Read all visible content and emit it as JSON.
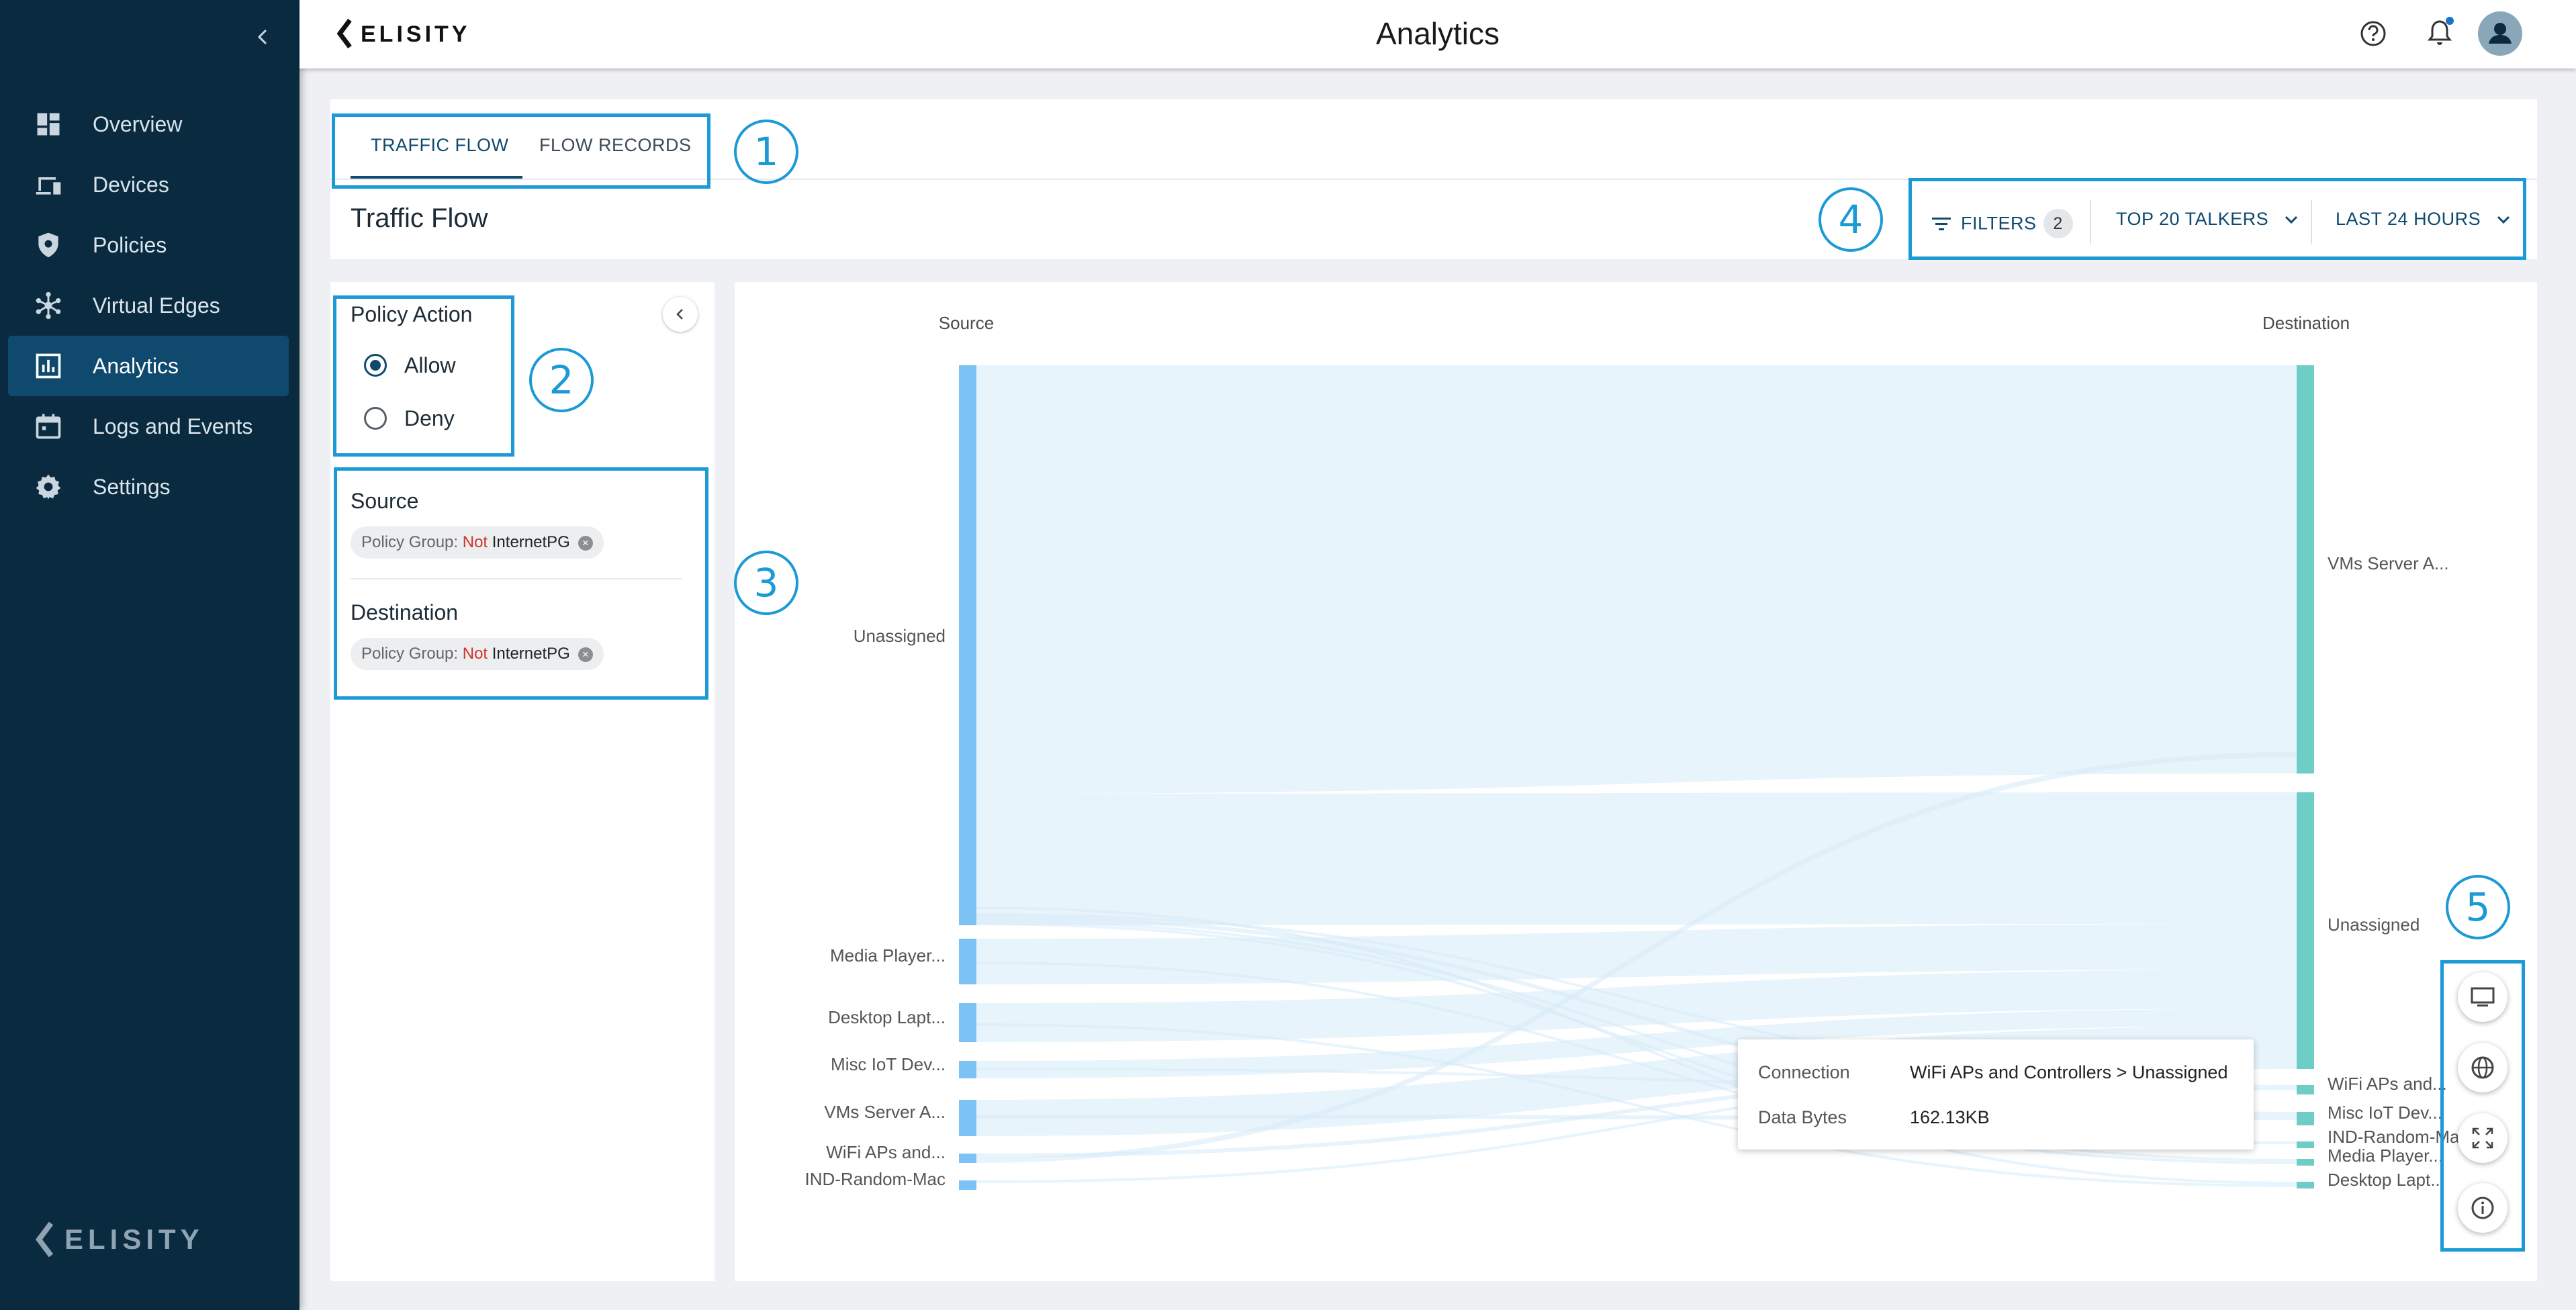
{
  "app": {
    "brand": "ELISITY",
    "page_title": "Analytics"
  },
  "sidebar": {
    "items": [
      {
        "label": "Overview",
        "icon": "dashboard-icon"
      },
      {
        "label": "Devices",
        "icon": "devices-icon"
      },
      {
        "label": "Policies",
        "icon": "shield-icon"
      },
      {
        "label": "Virtual Edges",
        "icon": "network-hub-icon"
      },
      {
        "label": "Analytics",
        "icon": "bar-chart-icon",
        "active": true
      },
      {
        "label": "Logs and Events",
        "icon": "calendar-icon"
      },
      {
        "label": "Settings",
        "icon": "gear-icon"
      }
    ],
    "footer_brand": "ELISITY"
  },
  "tabs": [
    {
      "label": "TRAFFIC FLOW",
      "active": true
    },
    {
      "label": "FLOW RECORDS",
      "active": false
    }
  ],
  "section_title": "Traffic Flow",
  "controls": {
    "filters_label": "FILTERS",
    "filters_count": "2",
    "talkers_label": "TOP 20 TALKERS",
    "range_label": "LAST 24 HOURS"
  },
  "filters_panel": {
    "policy_action": {
      "title": "Policy Action",
      "options": [
        {
          "label": "Allow",
          "selected": true
        },
        {
          "label": "Deny",
          "selected": false
        }
      ]
    },
    "source": {
      "title": "Source",
      "chip": {
        "key": "Policy Group: ",
        "negation": "Not",
        "value": " InternetPG"
      }
    },
    "destination": {
      "title": "Destination",
      "chip": {
        "key": "Policy Group: ",
        "negation": "Not",
        "value": " InternetPG"
      }
    }
  },
  "chart_data": {
    "type": "sankey",
    "source_header": "Source",
    "destination_header": "Destination",
    "sources": [
      "Unassigned",
      "Media Player...",
      "Desktop Lapt...",
      "Misc IoT Dev...",
      "VMs Server A...",
      "WiFi APs and...",
      "IND-Random-Mac"
    ],
    "destinations": [
      "VMs Server A...",
      "Unassigned",
      "WiFi APs and...",
      "Misc IoT Dev...",
      "IND-Random-Mac",
      "Media Player...",
      "Desktop Lapt..."
    ],
    "colors": {
      "source_node": "#7cc2f5",
      "destination_node": "#6ecdc7",
      "link": "#d5ebf8"
    }
  },
  "tooltip": {
    "connection_label": "Connection",
    "connection_value": "WiFi APs and Controllers > Unassigned",
    "bytes_label": "Data Bytes",
    "bytes_value": "162.13KB"
  },
  "annotations": [
    "1",
    "2",
    "3",
    "4",
    "5"
  ],
  "side_actions": [
    {
      "icon": "monitor-icon"
    },
    {
      "icon": "globe-icon"
    },
    {
      "icon": "fullscreen-icon"
    },
    {
      "icon": "info-icon"
    }
  ]
}
